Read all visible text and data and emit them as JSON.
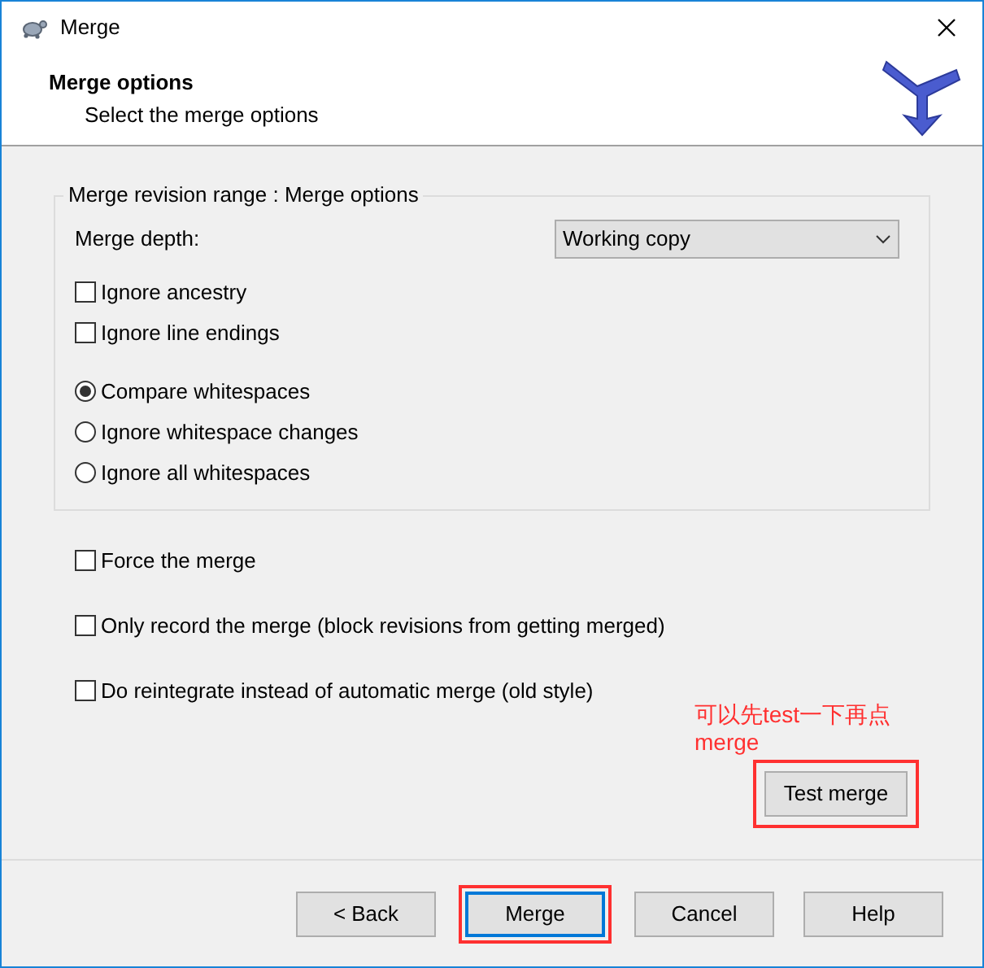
{
  "window": {
    "title": "Merge"
  },
  "header": {
    "title": "Merge options",
    "subtitle": "Select the merge options"
  },
  "group": {
    "legend": "Merge revision range : Merge options",
    "depth_label": "Merge depth:",
    "depth_value": "Working copy",
    "options": [
      {
        "kind": "checkbox",
        "label": "Ignore ancestry",
        "checked": false
      },
      {
        "kind": "checkbox",
        "label": "Ignore line endings",
        "checked": false
      },
      {
        "kind": "radio",
        "label": "Compare whitespaces",
        "selected": true
      },
      {
        "kind": "radio",
        "label": "Ignore whitespace changes",
        "selected": false
      },
      {
        "kind": "radio",
        "label": "Ignore all whitespaces",
        "selected": false
      }
    ]
  },
  "options": [
    {
      "label": "Force the merge",
      "checked": false
    },
    {
      "label": "Only record the merge (block revisions from getting merged)",
      "checked": false
    },
    {
      "label": "Do reintegrate instead of automatic merge (old style)",
      "checked": false
    }
  ],
  "annotation": "可以先test一下再点merge",
  "test_button": {
    "label": "Test merge",
    "highlighted": true
  },
  "buttons": [
    {
      "label": "< Back",
      "focused": false,
      "highlighted": false
    },
    {
      "label": "Merge",
      "focused": true,
      "highlighted": true
    },
    {
      "label": "Cancel",
      "focused": false,
      "highlighted": false
    },
    {
      "label": "Help",
      "focused": false,
      "highlighted": false
    }
  ]
}
